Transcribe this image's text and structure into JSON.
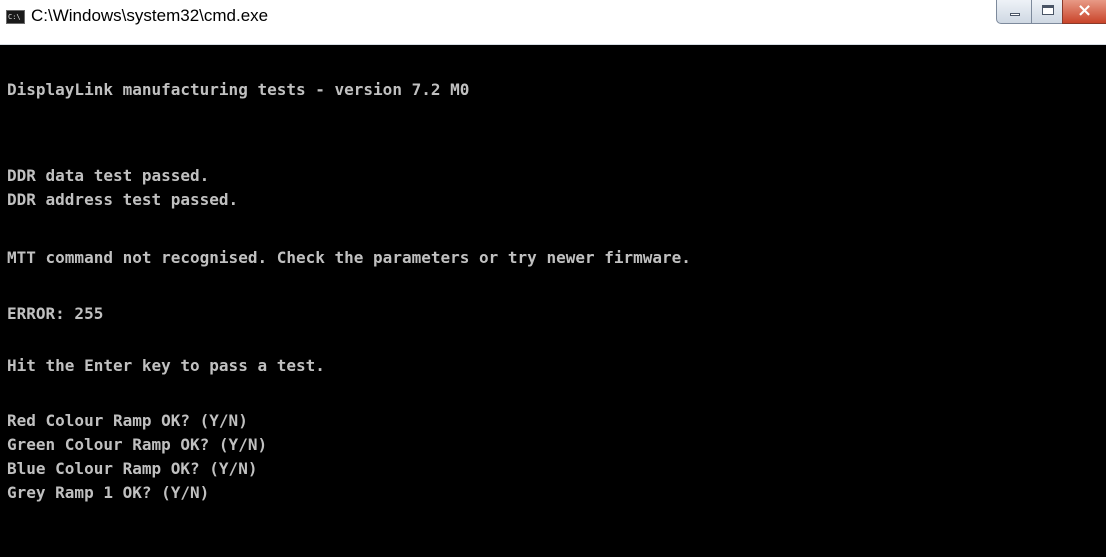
{
  "window": {
    "title": "C:\\Windows\\system32\\cmd.exe",
    "icon": "cmd-icon",
    "icon_text": "C:\\",
    "close_glyph": "×"
  },
  "console": {
    "lines": [
      "DisplayLink manufacturing tests - version 7.2 M0",
      "DDR data test passed.",
      "DDR address test passed.",
      "MTT command not recognised. Check the parameters or try newer firmware.",
      "ERROR: 255",
      "Hit the Enter key to pass a test.",
      "Red Colour Ramp OK? (Y/N)",
      "Green Colour Ramp OK? (Y/N)",
      "Blue Colour Ramp OK? (Y/N)",
      "Grey Ramp 1 OK? (Y/N)"
    ]
  },
  "colors": {
    "console_bg": "#000000",
    "console_text": "#c0c0c0",
    "close_button": "#c9442a"
  }
}
